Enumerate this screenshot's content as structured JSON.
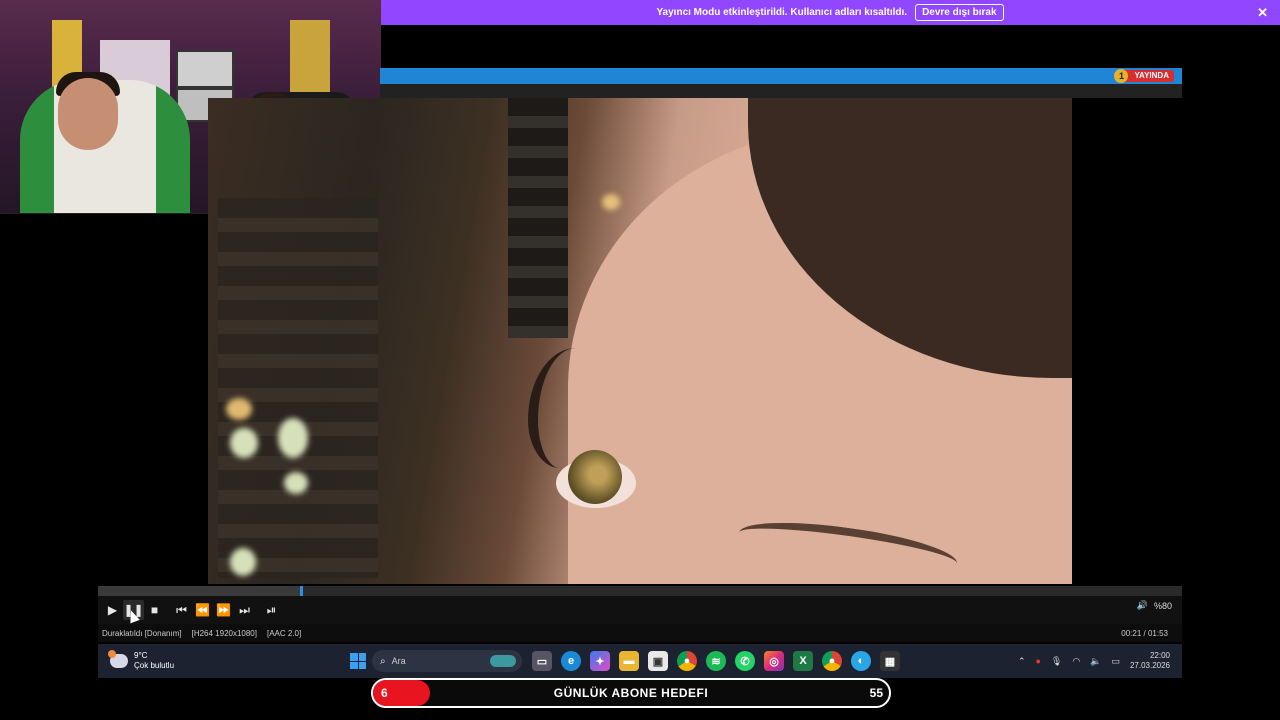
{
  "banner": {
    "message": "Yayıncı Modu etkinleştirildi. Kullanıcı adları kısaltıldı.",
    "disable_button": "Devre dışı bırak",
    "close_glyph": "✕"
  },
  "player": {
    "live_label": "YAYINDA",
    "live_count": "1",
    "accent_color": "#1f86d6",
    "seek_progress": 0.186,
    "volume_label": "%80",
    "status": {
      "state": "Duraklatıldı [Donanım]",
      "video_codec": "[H264 1920x1080]",
      "audio_codec": "[AAC 2.0]",
      "time": "00:21 / 01:53"
    },
    "controls": [
      "play-icon",
      "pause-icon",
      "stop-icon",
      "previous-icon",
      "rewind-icon",
      "fast-forward-icon",
      "next-icon",
      "frame-step-icon"
    ]
  },
  "taskbar": {
    "temperature": "9°C",
    "weather": "Çok bulutlu",
    "search_placeholder": "Ara",
    "clock_time": "22:00",
    "clock_date": "27.03.2026",
    "apps": [
      "file-view-icon",
      "edge-icon",
      "copilot-icon",
      "file-explorer-icon",
      "store-icon",
      "chrome-icon",
      "spotify-icon",
      "whatsapp-icon",
      "instagram-icon",
      "excel-icon",
      "chrome-profile-icon",
      "browser-icon",
      "player-app-icon"
    ]
  },
  "goal": {
    "title": "GÜNLÜK ABONE HEDEFI",
    "current": "6",
    "target": "55",
    "progress": 0.109,
    "color": "#e8141f"
  }
}
